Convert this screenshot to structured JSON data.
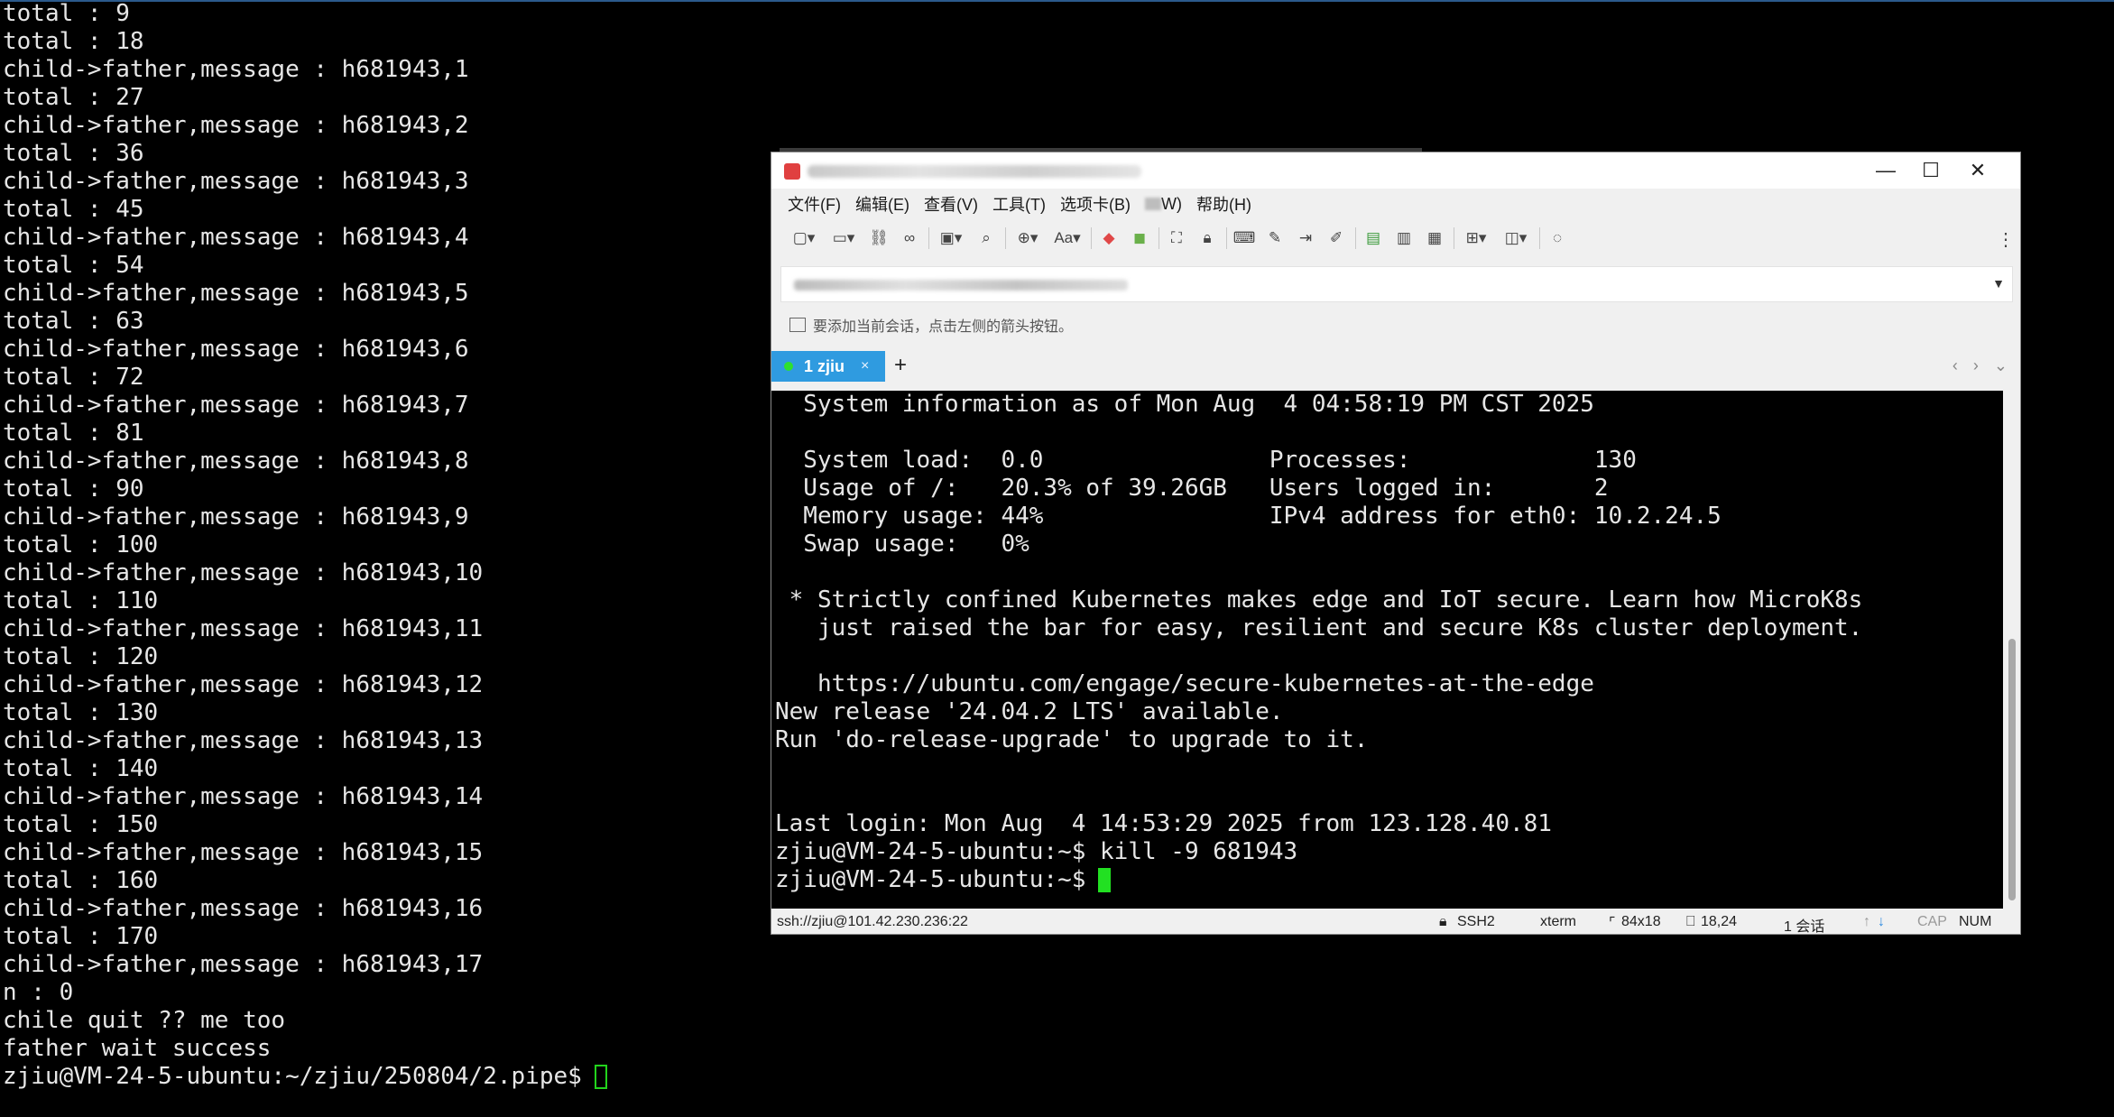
{
  "background_terminal": {
    "lines": [
      "total : 9",
      "total : 18",
      "child->father,message : h681943,1",
      "total : 27",
      "child->father,message : h681943,2",
      "total : 36",
      "child->father,message : h681943,3",
      "total : 45",
      "child->father,message : h681943,4",
      "total : 54",
      "child->father,message : h681943,5",
      "total : 63",
      "child->father,message : h681943,6",
      "total : 72",
      "child->father,message : h681943,7",
      "total : 81",
      "child->father,message : h681943,8",
      "total : 90",
      "child->father,message : h681943,9",
      "total : 100",
      "child->father,message : h681943,10",
      "total : 110",
      "child->father,message : h681943,11",
      "total : 120",
      "child->father,message : h681943,12",
      "total : 130",
      "child->father,message : h681943,13",
      "total : 140",
      "child->father,message : h681943,14",
      "total : 150",
      "child->father,message : h681943,15",
      "total : 160",
      "child->father,message : h681943,16",
      "total : 170",
      "child->father,message : h681943,17",
      "n : 0",
      "chile quit ?? me too",
      "father wait success"
    ],
    "prompt": "zjiu@VM-24-5-ubuntu:~/zjiu/250804/2.pipe$ "
  },
  "window": {
    "controls": {
      "minimize": "—",
      "maximize": "☐",
      "close": "✕"
    },
    "menu": {
      "file": "文件(F)",
      "edit": "编辑(E)",
      "view": "查看(V)",
      "tools": "工具(T)",
      "tabs": "选项卡(B)",
      "window_suffix": "W)",
      "help": "帮助(H)"
    },
    "session_hint": "要添加当前会话，点击左侧的箭头按钮。",
    "tab": {
      "label": "1 zjiu",
      "close": "×",
      "add": "+"
    },
    "tab_nav": "‹ › ⌄",
    "terminal_lines": [
      "  System information as of Mon Aug  4 04:58:19 PM CST 2025",
      "",
      "  System load:  0.0                Processes:             130",
      "  Usage of /:   20.3% of 39.26GB   Users logged in:       2",
      "  Memory usage: 44%                IPv4 address for eth0: 10.2.24.5",
      "  Swap usage:   0%",
      "",
      " * Strictly confined Kubernetes makes edge and IoT secure. Learn how MicroK8s",
      "   just raised the bar for easy, resilient and secure K8s cluster deployment.",
      "",
      "   https://ubuntu.com/engage/secure-kubernetes-at-the-edge",
      "New release '24.04.2 LTS' available.",
      "Run 'do-release-upgrade' to upgrade to it.",
      "",
      "",
      "Last login: Mon Aug  4 14:53:29 2025 from 123.128.40.81",
      "zjiu@VM-24-5-ubuntu:~$ kill -9 681943"
    ],
    "terminal_prompt": "zjiu@VM-24-5-ubuntu:~$ ",
    "status": {
      "connection": "ssh://zjiu@101.42.230.236:22",
      "protocol": "SSH2",
      "term_type": "xterm",
      "size": "84x18",
      "cursor_pos": "18,24",
      "sessions": "1 会话",
      "cap": "CAP",
      "num": "NUM"
    }
  },
  "colors": {
    "terminal_bg": "#000000",
    "terminal_fg": "#e6e6e6",
    "cursor": "#22e022",
    "tab_active": "#2f9be0"
  }
}
